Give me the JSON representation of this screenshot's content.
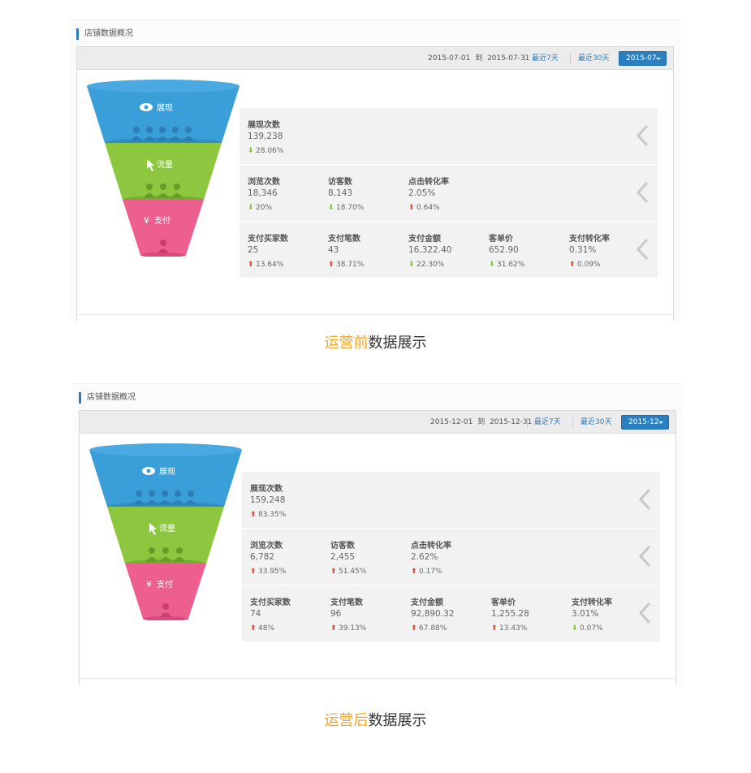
{
  "sections": [
    {
      "card": {
        "title": "店铺数据概况",
        "date_start": "2015-07-01",
        "date_to": "到",
        "date_end": "2015-07-31",
        "last7": "最近7天",
        "last30": "最近30天",
        "month": "2015-07"
      },
      "funnel": {
        "impressions": "展现",
        "traffic": "流量",
        "payment": "支付",
        "eye_icon": "eye-icon",
        "cursor_icon": "cursor-icon",
        "yen_symbol": "¥"
      },
      "rows": [
        [
          {
            "label": "展现次数",
            "value": "139,238",
            "change": "28.06%",
            "direction": "down"
          }
        ],
        [
          {
            "label": "浏览次数",
            "value": "18,346",
            "change": "20%",
            "direction": "down"
          },
          {
            "label": "访客数",
            "value": "8,143",
            "change": "18.70%",
            "direction": "down"
          },
          {
            "label": "点击转化率",
            "value": "2.05%",
            "change": "0.64%",
            "direction": "up"
          }
        ],
        [
          {
            "label": "支付买家数",
            "value": "25",
            "change": "13.64%",
            "direction": "up"
          },
          {
            "label": "支付笔数",
            "value": "43",
            "change": "38.71%",
            "direction": "up"
          },
          {
            "label": "支付金额",
            "value": "16,322.40",
            "change": "22.30%",
            "direction": "down"
          },
          {
            "label": "客单价",
            "value": "652.90",
            "change": "31.62%",
            "direction": "down"
          },
          {
            "label": "支付转化率",
            "value": "0.31%",
            "change": "0.09%",
            "direction": "up"
          }
        ]
      ],
      "caption": {
        "highlight": "运营前",
        "rest": "数据展示"
      }
    },
    {
      "card": {
        "title": "店铺数据概况",
        "date_start": "2015-12-01",
        "date_to": "到",
        "date_end": "2015-12-31",
        "last7": "最近7天",
        "last30": "最近30天",
        "month": "2015-12"
      },
      "funnel": {
        "impressions": "展现",
        "traffic": "流量",
        "payment": "支付",
        "eye_icon": "eye-icon",
        "cursor_icon": "cursor-icon",
        "yen_symbol": "¥"
      },
      "rows": [
        [
          {
            "label": "展现次数",
            "value": "159,248",
            "change": "83.35%",
            "direction": "up"
          }
        ],
        [
          {
            "label": "浏览次数",
            "value": "6,782",
            "change": "33.95%",
            "direction": "up"
          },
          {
            "label": "访客数",
            "value": "2,455",
            "change": "51.45%",
            "direction": "up"
          },
          {
            "label": "点击转化率",
            "value": "2.62%",
            "change": "0.17%",
            "direction": "up"
          }
        ],
        [
          {
            "label": "支付买家数",
            "value": "74",
            "change": "48%",
            "direction": "up"
          },
          {
            "label": "支付笔数",
            "value": "96",
            "change": "39.13%",
            "direction": "up"
          },
          {
            "label": "支付金额",
            "value": "92,890.32",
            "change": "67.88%",
            "direction": "up"
          },
          {
            "label": "客单价",
            "value": "1,255.28",
            "change": "13.43%",
            "direction": "up"
          },
          {
            "label": "支付转化率",
            "value": "3.01%",
            "change": "0.07%",
            "direction": "down"
          }
        ]
      ],
      "caption": {
        "highlight": "运营后",
        "rest": "数据展示"
      }
    }
  ],
  "colors": {
    "accent": "#2f7ab9",
    "up": "#e74c3c",
    "down": "#8bc34a",
    "funnel_blue": "#3a9fd8",
    "funnel_green": "#8dc63f",
    "funnel_pink": "#ec5f8e",
    "highlight": "#f5a623"
  }
}
